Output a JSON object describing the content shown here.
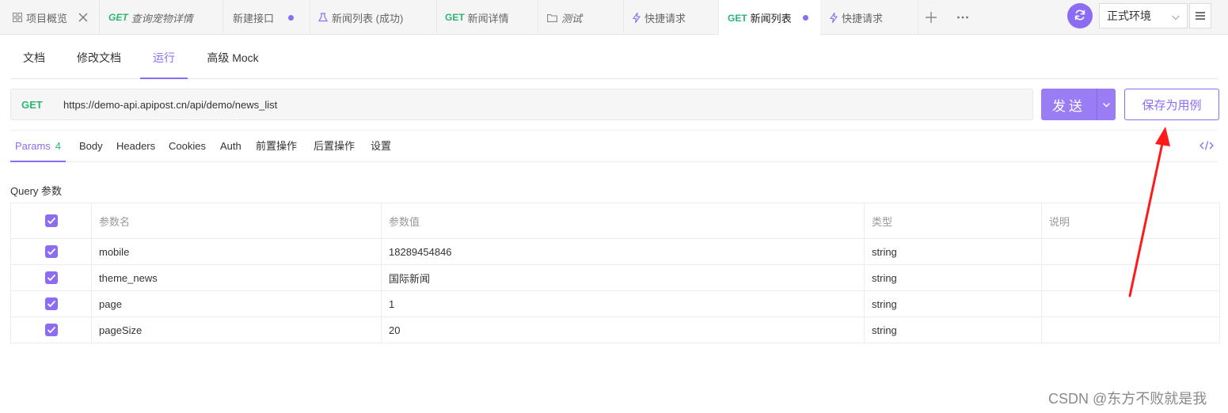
{
  "tabs": [
    {
      "method": "",
      "label": "项目概览",
      "icon": "grid-icon",
      "close": true
    },
    {
      "method": "GET",
      "label": "查询宠物详情",
      "italic": true
    },
    {
      "method": "",
      "label": "新建接口",
      "dot": true
    },
    {
      "method": "",
      "label": "新闻列表 (成功)",
      "icon": "example-icon"
    },
    {
      "method": "GET",
      "label": "新闻详情"
    },
    {
      "method": "",
      "label": "测试",
      "icon": "folder-icon",
      "italic": true
    },
    {
      "method": "",
      "label": "快捷请求",
      "icon": "lightning-icon"
    },
    {
      "method": "GET",
      "label": "新闻列表",
      "dot": true,
      "active": true
    },
    {
      "method": "",
      "label": "快捷请求",
      "icon": "lightning-icon"
    }
  ],
  "env": {
    "selected": "正式环境"
  },
  "subtabs": [
    "文档",
    "修改文档",
    "运行",
    "高级 Mock"
  ],
  "request": {
    "method": "GET",
    "url": "https://demo-api.apipost.cn/api/demo/news_list",
    "send_label": "发送",
    "save_label": "保存为用例"
  },
  "param_tabs": [
    {
      "label": "Params",
      "count": "4",
      "active": true
    },
    {
      "label": "Body"
    },
    {
      "label": "Headers"
    },
    {
      "label": "Cookies"
    },
    {
      "label": "Auth"
    },
    {
      "label": "前置操作"
    },
    {
      "label": "后置操作"
    },
    {
      "label": "设置"
    }
  ],
  "query": {
    "title": "Query 参数",
    "headers": [
      "参数名",
      "参数值",
      "类型",
      "说明"
    ],
    "rows": [
      {
        "name": "mobile",
        "value": "18289454846",
        "type": "string",
        "desc": ""
      },
      {
        "name": "theme_news",
        "value": "国际新闻",
        "type": "string",
        "desc": ""
      },
      {
        "name": "page",
        "value": "1",
        "type": "string",
        "desc": ""
      },
      {
        "name": "pageSize",
        "value": "20",
        "type": "string",
        "desc": ""
      }
    ]
  },
  "watermark": "CSDN @东方不败就是我",
  "colors": {
    "accent": "#8c6cf2",
    "method_get": "#2bb673",
    "annotation_arrow": "#ff1a1a"
  }
}
